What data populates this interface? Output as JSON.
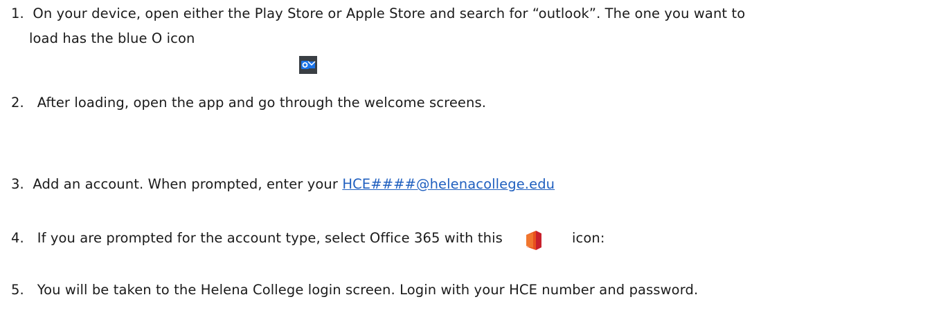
{
  "instructions": {
    "step1_num": "1.",
    "step1_line1": "On your device, open either the Play Store or Apple Store and search for “outlook”.  The one you want to",
    "step1_line2": "load has the blue O icon",
    "step2_num": "2.",
    "step2_text": "After loading, open the app and go through the welcome screens.",
    "step3_num": "3.",
    "step3_text": "Add an account.  When prompted, enter your ",
    "step3_link": "HCE####@helenacollege.edu",
    "step4_num": "4.",
    "step4_text_before": "If you are prompted for the account type, select Office 365 with this",
    "step4_text_after": "icon:",
    "step5_num": "5.",
    "step5_text": "You will be taken to the Helena College login screen.  Login with your HCE number and password."
  },
  "icons": {
    "outlook": "outlook-icon",
    "office": "office-365-icon"
  },
  "colors": {
    "link": "#1f5fbf",
    "outlook_blue": "#1a73e8",
    "office_orange": "#e8501e",
    "office_red": "#c8202c"
  }
}
